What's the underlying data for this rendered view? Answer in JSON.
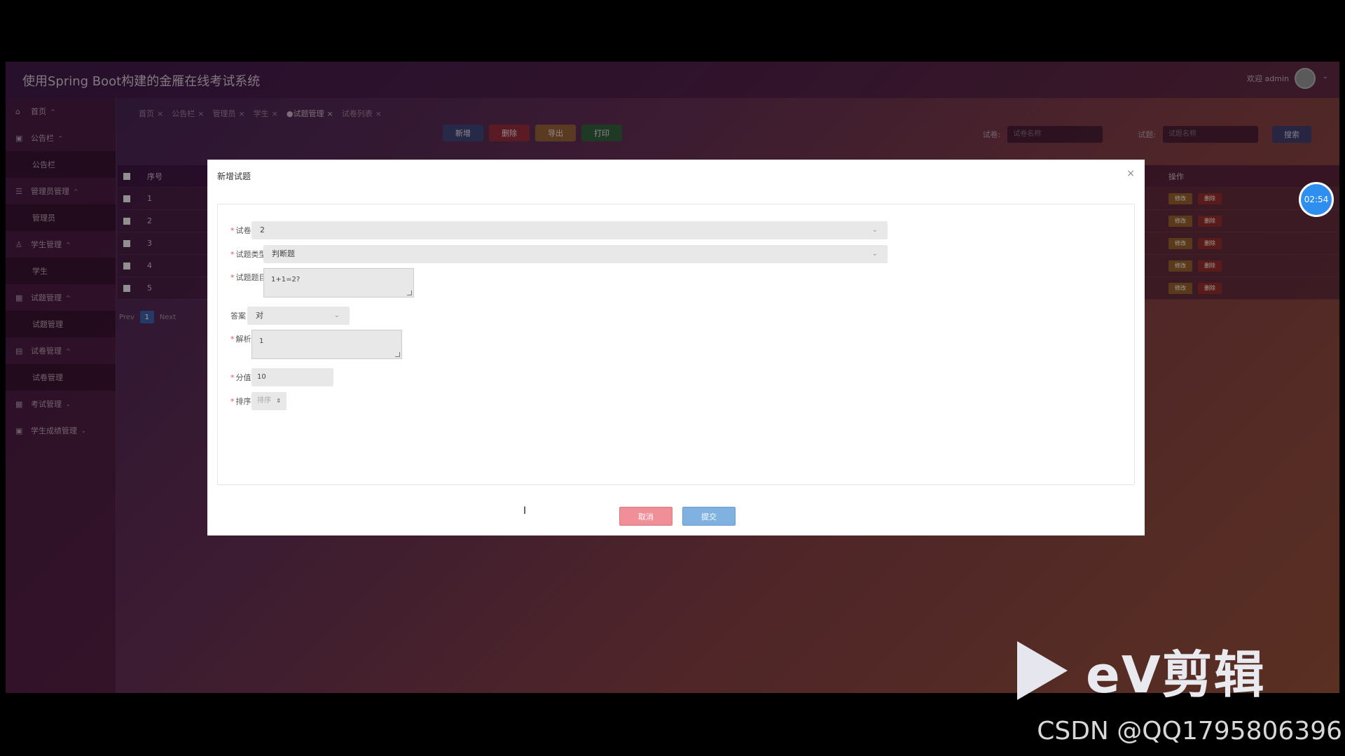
{
  "app": {
    "title": "使用Spring Boot构建的金雁在线考试系统",
    "welcome": "欢迎 admin"
  },
  "sidebar": {
    "items": [
      {
        "label": "首页"
      },
      {
        "label": "公告栏"
      },
      {
        "label": "公告栏"
      },
      {
        "label": "管理员管理"
      },
      {
        "label": "管理员"
      },
      {
        "label": "学生管理"
      },
      {
        "label": "学生"
      },
      {
        "label": "试题管理"
      },
      {
        "label": "试题管理"
      },
      {
        "label": "试卷管理"
      },
      {
        "label": "试卷管理"
      },
      {
        "label": "考试管理"
      },
      {
        "label": "学生成绩管理"
      }
    ]
  },
  "tabs": [
    "首页",
    "公告栏",
    "管理员",
    "学生",
    "●试题管理",
    "试卷列表"
  ],
  "toolbar": {
    "add": "新增",
    "delete": "删除",
    "export": "导出",
    "print": "打印"
  },
  "search": {
    "label1": "试卷:",
    "placeholder1": "试卷名称",
    "label2": "试题:",
    "placeholder2": "试题名称",
    "button": "搜索"
  },
  "table": {
    "headers": {
      "seq": "序号",
      "ops": "操作"
    },
    "rows": [
      "1",
      "2",
      "3",
      "4",
      "5"
    ],
    "edit_label": "修改",
    "delete_label": "删除"
  },
  "pager": {
    "prev": "Prev",
    "page": "1",
    "next": "Next"
  },
  "timer": "02:54",
  "modal": {
    "title": "新增试题",
    "close": "×",
    "fields": {
      "paper_label": "试卷",
      "paper_value": "2",
      "type_label": "试题类型",
      "type_value": "判断题",
      "question_label": "试题题目",
      "question_value": "1+1=2?",
      "answer_label": "答案",
      "answer_value": "对",
      "analysis_label": "解析",
      "analysis_value": "1",
      "score_label": "分值",
      "score_value": "10",
      "order_label": "排序",
      "order_placeholder": "排序"
    },
    "cancel": "取消",
    "submit": "提交"
  },
  "watermark": {
    "brand": "eV剪辑",
    "csdn": "CSDN @QQ1795806396"
  },
  "colors": {
    "add": "#3b3f6e",
    "delete": "#8a2a3a",
    "export": "#8a5a32",
    "print": "#2e5a3a",
    "edit": "#8a5a2a",
    "del": "#8a2a2a"
  }
}
